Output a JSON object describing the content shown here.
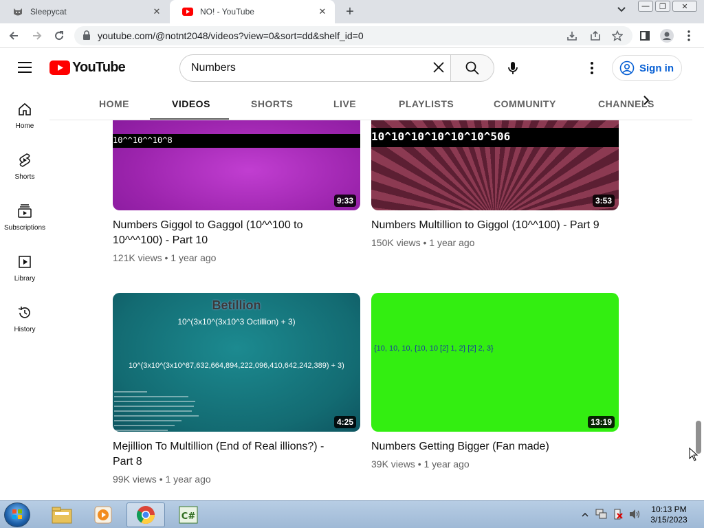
{
  "browser": {
    "tabs": [
      {
        "title": "Sleepycat",
        "icon": "cat-favicon-icon",
        "close": "✕"
      },
      {
        "title": "NO! - YouTube",
        "icon": "youtube-favicon-icon",
        "close": "✕"
      }
    ],
    "new_tab": "+",
    "url": "youtube.com/@notnt2048/videos?view=0&sort=dd&shelf_id=0"
  },
  "youtube": {
    "logo_text": "YouTube",
    "search_value": "Numbers",
    "sign_in": "Sign in",
    "left_nav": [
      {
        "label": "Home",
        "icon": "home-icon"
      },
      {
        "label": "Shorts",
        "icon": "shorts-icon"
      },
      {
        "label": "Subscriptions",
        "icon": "subscriptions-icon"
      },
      {
        "label": "Library",
        "icon": "library-icon"
      },
      {
        "label": "History",
        "icon": "history-icon"
      }
    ],
    "channel_tabs": [
      "HOME",
      "VIDEOS",
      "SHORTS",
      "LIVE",
      "PLAYLISTS",
      "COMMUNITY",
      "CHANNELS"
    ],
    "active_tab": "VIDEOS"
  },
  "videos": [
    {
      "title": "Numbers Giggol to Gaggol (10^^100 to 10^^^100) - Part 10",
      "meta": "121K views • 1 year ago",
      "duration": "9:33",
      "thumb_text": "10^^10^^10^8"
    },
    {
      "title": "Numbers Multillion to Giggol (10^^100) - Part 9",
      "meta": "150K views • 1 year ago",
      "duration": "3:53",
      "thumb_text": "10^10^10^10^10^10^506"
    },
    {
      "title": "Mejillion To Multillion (End of Real illions?) - Part 8",
      "meta": "99K views • 1 year ago",
      "duration": "4:25",
      "thumb_heading": "Betillion",
      "thumb_line1": "10^(3x10^(3x10^3 Octillion) + 3)",
      "thumb_line2": "10^(3x10^(3x10^87,632,664,894,222,096,410,642,242,389) + 3)"
    },
    {
      "title": "Numbers Getting Bigger (Fan made)",
      "meta": "39K views • 1 year ago",
      "duration": "13:19",
      "thumb_text": "{10, 10, 10, {10, 10 [2] 1, 2} [2] 2, 3}"
    }
  ],
  "taskbar": {
    "time": "10:13 PM",
    "date": "3/15/2023",
    "apps": [
      "file-explorer-icon",
      "media-player-icon",
      "chrome-icon",
      "csharp-icon"
    ]
  }
}
